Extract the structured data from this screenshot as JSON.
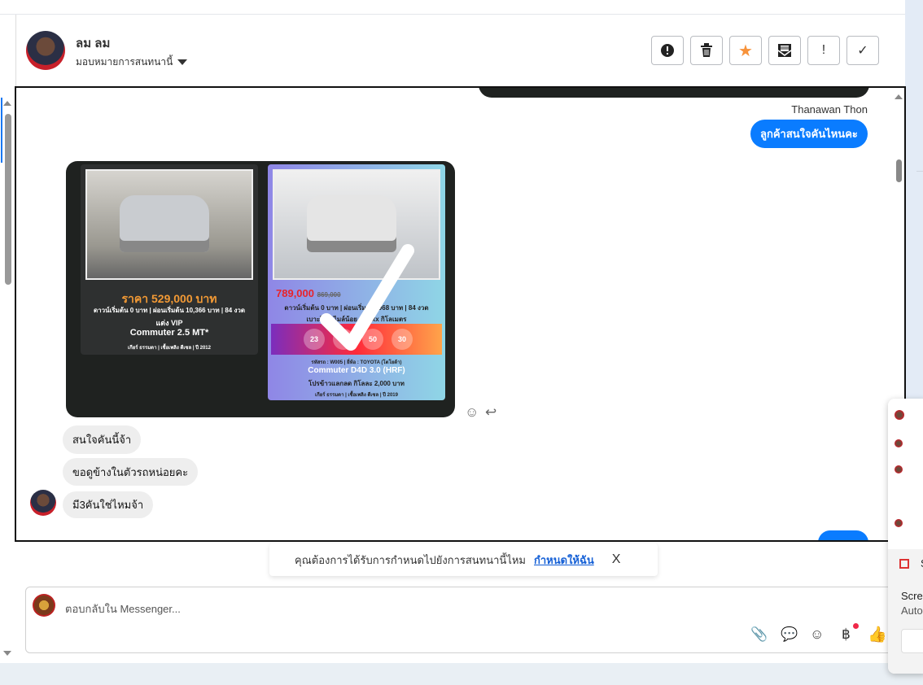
{
  "header": {
    "contact_name": "ลม ลม",
    "assign_label": "มอบหมายการสนทนานี้"
  },
  "toolbar": {
    "buttons": [
      {
        "name": "spam",
        "glyph": "!"
      },
      {
        "name": "delete",
        "glyph": "🗑"
      },
      {
        "name": "star",
        "glyph": "★"
      },
      {
        "name": "mark-unread",
        "glyph": "✉"
      },
      {
        "name": "important",
        "glyph": "!"
      },
      {
        "name": "done",
        "glyph": "✓"
      }
    ],
    "star_color": "#f7923a"
  },
  "messages": {
    "sender_name": "Thanawan Thon",
    "outgoing_1": "ลูกค้าสนใจคันไหนคะ",
    "incoming": [
      "สนใจคันนี้จ้า",
      "ขอดูข้างในตัวรถหน่อยคะ",
      "มี3คันใช่ไหมจ้า"
    ]
  },
  "ad_image": {
    "left": {
      "price": "ราคา 529,000 บาท",
      "terms": "ดาวน์เริ่มต้น 0 บาท | ผ่อนเริ่มต้น 10,366 บาท | 84 งวด",
      "tag": "แต่ง VIP",
      "model": "Commuter 2.5 MT*",
      "specs": "เกียร์ ธรรมดา | เชื้อเพลิง ดีเซล | ปี 2012"
    },
    "right": {
      "price": "789,000",
      "old_price": "869,000",
      "terms": "ดาวน์เริ่มต้น 0 บาท | ผ่อนเริ่มต้น ,968 บาท | 84 งวด",
      "mileage": "เบาะใหม่ ไมล์น้อย xx,xxx กิโลเมตร",
      "timer": [
        "23",
        "",
        "50",
        "30"
      ],
      "brand": "รหัสรถ : W005 | ยี่ห้อ : TOYOTA (โตโยต้า)",
      "model": "Commuter D4D 3.0 (HRF)",
      "promo": "โปรข้าวแลกลด กิโลละ 2,000 บาท",
      "specs": "เกียร์ ธรรมดา | เชื้อเพลิง ดีเซล | ปี 2019"
    }
  },
  "banner": {
    "text": "คุณต้องการได้รับการกำหนดไปยังการสนทนานี้ไหม",
    "link": "กำหนดให้ฉัน",
    "close": "X"
  },
  "composer": {
    "placeholder": "ตอบกลับใน Messenger..."
  },
  "floating_panel": {
    "title_partial": "S",
    "line1": "Scre",
    "line2": "Auto"
  },
  "colors": {
    "accent": "#0a7cff",
    "notification": "#f02849"
  }
}
